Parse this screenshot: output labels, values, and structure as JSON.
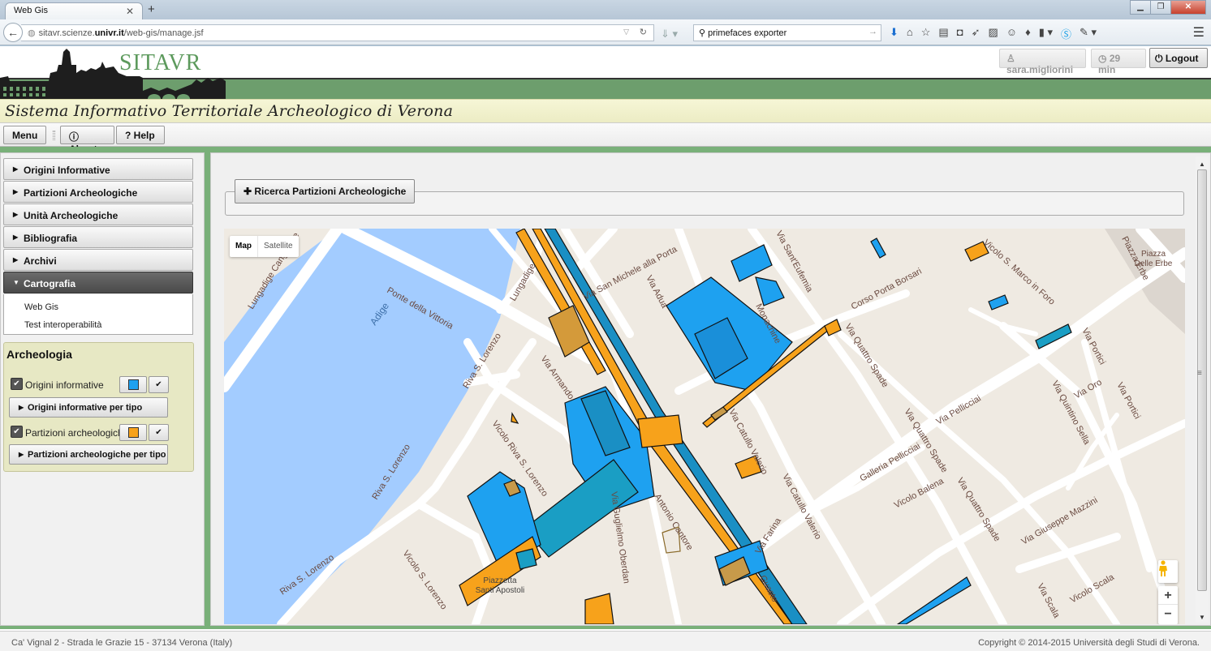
{
  "browser": {
    "tab_title": "Web Gis",
    "url_prefix": "sitavr.scienze.",
    "url_domain": "univr.it",
    "url_path": "/web-gis/manage.jsf",
    "search_value": "primefaces exporter"
  },
  "header": {
    "logo_text": "SITAVR",
    "user": "sara.migliorini",
    "session_time": "29 min",
    "logout_label": "Logout",
    "site_title": "Sistema Informativo Territoriale Archeologico di Verona"
  },
  "menubar": {
    "menu_label": "Menu",
    "about_label": "About",
    "help_label": "Help"
  },
  "sidebar": {
    "accordion": [
      {
        "label": "Origini Informative",
        "expanded": false
      },
      {
        "label": "Partizioni Archeologiche",
        "expanded": false
      },
      {
        "label": "Unità Archeologiche",
        "expanded": false
      },
      {
        "label": "Bibliografia",
        "expanded": false
      },
      {
        "label": "Archivi",
        "expanded": false
      },
      {
        "label": "Cartografia",
        "expanded": true
      }
    ],
    "cartografia_items": [
      "Web Gis",
      "Test interoperabilità"
    ]
  },
  "layers": {
    "title": "Archeologia",
    "items": [
      {
        "label": "Origini informative",
        "checked": true,
        "color": "#1ea1f0",
        "type_button": "Origini informative per tipo"
      },
      {
        "label": "Partizioni archeologiche",
        "checked": true,
        "color": "#f7a21b",
        "type_button": "Partizioni archeologiche per tipo"
      }
    ]
  },
  "main": {
    "search_panel_label": "Ricerca Partizioni Archeologiche"
  },
  "map": {
    "type_map": "Map",
    "type_satellite": "Satellite",
    "selected_type": "Map",
    "labels": {
      "adige": "Adige",
      "ponte_vittoria": "Ponte della Vittoria",
      "lungadige_cangrande": "Lungadige Cangrande",
      "lungadige": "Lungadige",
      "riva_lorenzo_1": "Riva S. Lorenzo",
      "riva_lorenzo_2": "Riva S. Lorenzo",
      "riva_lorenzo_3": "Riva S. Lorenzo",
      "vicolo_lorenzo": "Vicolo S. Lorenzo",
      "vicolo_riva_lorenzo": "Vicolo Riva S. Lorenzo",
      "via_armando": "Via Armando",
      "via_san_michele": "Via San Michele alla Porta",
      "via_adua": "Via Adua",
      "via_sant_eufemia": "Via Sant'Eufemia",
      "corso_porta_borsari": "Corso Porta Borsari",
      "vicolo_san_marco": "Vicolo S. Marco in Foro",
      "piazza_erbe": "Piazza Erbe",
      "piazza_delle_erbe": "Piazza Delle Erbe",
      "via_quattro_spade_1": "Via Quattro Spade",
      "via_quattro_spade_2": "Via Quattro Spade",
      "via_quattro_spade_3": "Via Quattro Spade",
      "via_portici_1": "Via Portici",
      "via_portici_2": "Via Portici",
      "via_oro": "Via Oro",
      "via_pellicciai": "Via Pellicciai",
      "via_quintino_sella": "Via Quintino Sella",
      "galleria_pellicciai": "Galleria Pellicciai",
      "vicolo_balena": "Vicolo Balena",
      "via_catullo_1": "Via Catullo Valerio",
      "via_catullo_2": "Via Catullo Valerio",
      "via_giuseppe_mazzini": "Via Giuseppe Mazzini",
      "vicolo_scala": "Vicolo Scala",
      "via_scala": "Via Scala",
      "via_farina": "Via Farina",
      "via_oberdan": "Via Guglielmo Oberdan",
      "cantore": "Antonio Cantore",
      "piazzetta_apostoli": "Piazzetta Santi Apostoli",
      "monachine": "Monachine",
      "guasto": "Guasto"
    }
  },
  "footer": {
    "address": "Ca' Vignal 2 - Strada le Grazie 15 - 37134 Verona (Italy)",
    "copyright": "Copyright © 2014-2015 Università degli Studi di Verona."
  }
}
